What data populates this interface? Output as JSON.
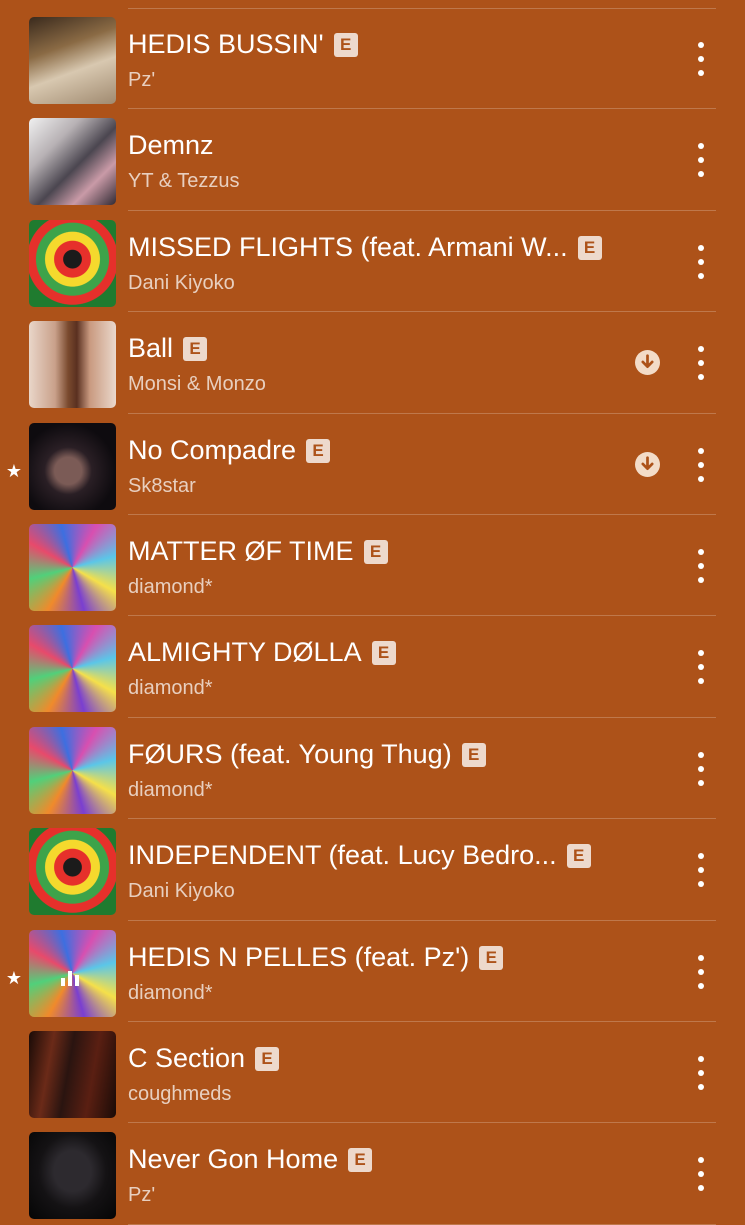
{
  "songs": [
    {
      "title": "HEDIS BUSSIN'",
      "artist": "Pz'",
      "explicit": "E",
      "starred": false,
      "downloaded": false
    },
    {
      "title": "Demnz",
      "artist": "YT & Tezzus",
      "explicit": "",
      "starred": false,
      "downloaded": false
    },
    {
      "title": "MISSED FLIGHTS (feat. Armani W...",
      "artist": "Dani Kiyoko",
      "explicit": "E",
      "starred": false,
      "downloaded": false
    },
    {
      "title": "Ball",
      "artist": "Monsi & Monzo",
      "explicit": "E",
      "starred": false,
      "downloaded": true
    },
    {
      "title": "No Compadre",
      "artist": "Sk8star",
      "explicit": "E",
      "starred": true,
      "downloaded": true
    },
    {
      "title": "MATTER ØF TIME",
      "artist": "diamond*",
      "explicit": "E",
      "starred": false,
      "downloaded": false
    },
    {
      "title": "ALMIGHTY DØLLA",
      "artist": "diamond*",
      "explicit": "E",
      "starred": false,
      "downloaded": false
    },
    {
      "title": "FØURS (feat. Young Thug)",
      "artist": "diamond*",
      "explicit": "E",
      "starred": false,
      "downloaded": false
    },
    {
      "title": "INDEPENDENT (feat. Lucy Bedro...",
      "artist": "Dani Kiyoko",
      "explicit": "E",
      "starred": false,
      "downloaded": false
    },
    {
      "title": "HEDIS N PELLES (feat. Pz')",
      "artist": "diamond*",
      "explicit": "E",
      "starred": true,
      "downloaded": false,
      "now_playing": true
    },
    {
      "title": "C Section",
      "artist": "coughmeds",
      "explicit": "E",
      "starred": false,
      "downloaded": false
    },
    {
      "title": "Never Gon Home",
      "artist": "Pz'",
      "explicit": "E",
      "starred": false,
      "downloaded": false
    }
  ],
  "icons": {
    "star": "star-icon",
    "download": "download-icon",
    "more": "more-icon",
    "playing": "now-playing-bars-icon"
  },
  "colors": {
    "background": "#ad5219",
    "text": "#ffffff",
    "badge": "#f3dcc8"
  }
}
